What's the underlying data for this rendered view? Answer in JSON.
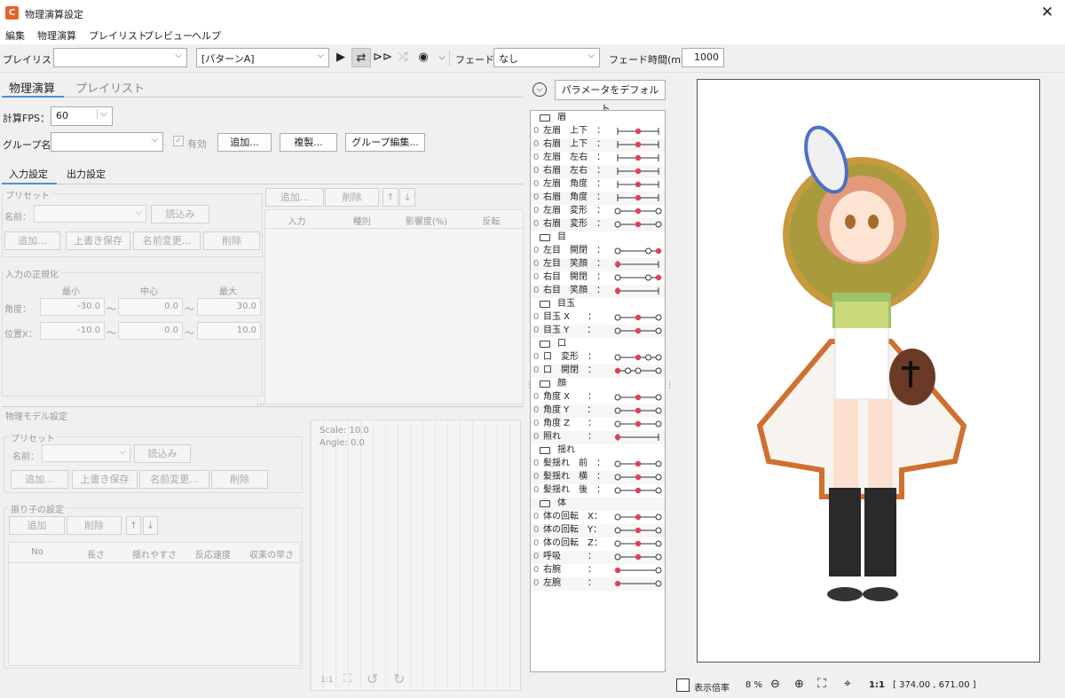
{
  "window": {
    "title": "物理演算設定",
    "close": "✕"
  },
  "menu": [
    "編集",
    "物理演算",
    "プレイリスト",
    "プレビュー",
    "ヘルプ"
  ],
  "toolbar": {
    "playlist_label": "プレイリスト：",
    "playlist_value": "",
    "pattern_value": "[パターンA]",
    "fade_label": "フェード：",
    "fade_value": "なし",
    "fade_time_label": "フェード時間(ms)：",
    "fade_time_value": "1000"
  },
  "tabs": {
    "main": [
      "物理演算",
      "プレイリスト"
    ],
    "sub": [
      "入力設定",
      "出力設定"
    ]
  },
  "physics": {
    "fps_label": "計算FPS：",
    "fps_value": "60",
    "group_label": "グループ名：",
    "enabled_label": "有効",
    "buttons": [
      "追加...",
      "複製...",
      "グループ編集..."
    ]
  },
  "input": {
    "preset_title": "プリセット",
    "name_label": "名前：",
    "load": "読込み",
    "preset_buttons": [
      "追加...",
      "上書き保存",
      "名前変更...",
      "削除"
    ],
    "table_buttons": [
      "追加...",
      "削除",
      "↑",
      "↓"
    ],
    "table_headers": [
      "入力",
      "種別",
      "影響度(%)",
      "反転"
    ],
    "normalize_title": "入力の正規化",
    "norm_headers": [
      "最小",
      "中心",
      "最大"
    ],
    "angle_label": "角度：",
    "angle": [
      "-30.0",
      "0.0",
      "30.0"
    ],
    "posx_label": "位置X：",
    "posx": [
      "-10.0",
      "0.0",
      "10.0"
    ],
    "tilde": "〜"
  },
  "model": {
    "title": "物理モデル設定",
    "preset_title": "プリセット",
    "name_label": "名前：",
    "load": "読込み",
    "preset_buttons": [
      "追加...",
      "上書き保存",
      "名前変更...",
      "削除"
    ],
    "pendulum_title": "振り子の設定",
    "pend_buttons": [
      "追加",
      "削除",
      "↑",
      "↓"
    ],
    "pend_headers": [
      "No",
      "長さ",
      "揺れやすさ",
      "反応速度",
      "収束の早さ"
    ],
    "scale": "Scale: 10.0",
    "angle": "Angle: 0.0",
    "ratio": "1:1"
  },
  "params": {
    "default_btn": "パラメータをデフォルト...",
    "rows": [
      {
        "type": "cat",
        "label": "眉"
      },
      {
        "label": "左眉　上下　：",
        "dots": [
          0.5
        ]
      },
      {
        "label": "右眉　上下　：",
        "dots": [
          0.5
        ]
      },
      {
        "label": "左眉　左右　：",
        "dots": [
          0.5
        ]
      },
      {
        "label": "右眉　左右　：",
        "dots": [
          0.5
        ]
      },
      {
        "label": "左眉　角度　：",
        "dots": [
          0.5
        ]
      },
      {
        "label": "右眉　角度　：",
        "dots": [
          0.5
        ]
      },
      {
        "label": "左眉　変形　：",
        "dots": [
          0.5
        ],
        "rings": [
          0,
          1
        ]
      },
      {
        "label": "右眉　変形　：",
        "dots": [
          0.5
        ],
        "rings": [
          0,
          1
        ]
      },
      {
        "type": "cat",
        "label": "目"
      },
      {
        "label": "左目　開閉　：",
        "dots": [
          1
        ],
        "rings": [
          0,
          0.75
        ]
      },
      {
        "label": "左目　笑顔　：",
        "dots": [
          0
        ]
      },
      {
        "label": "右目　開閉　：",
        "dots": [
          1
        ],
        "rings": [
          0,
          0.75
        ]
      },
      {
        "label": "右目　笑顔　：",
        "dots": [
          0
        ]
      },
      {
        "type": "cat",
        "label": "目玉"
      },
      {
        "label": "目玉 X　　：",
        "dots": [
          0.5
        ],
        "rings": [
          0,
          1
        ]
      },
      {
        "label": "目玉 Y　　：",
        "dots": [
          0.5
        ],
        "rings": [
          0,
          1
        ]
      },
      {
        "type": "cat",
        "label": "口"
      },
      {
        "label": "口　変形　：",
        "dots": [
          0.5
        ],
        "rings": [
          0,
          0.75,
          1
        ]
      },
      {
        "label": "口　開閉　：",
        "dots": [
          0
        ],
        "rings": [
          0.25,
          0.5,
          1
        ]
      },
      {
        "type": "cat",
        "label": "顔"
      },
      {
        "label": "角度 X　　：",
        "dots": [
          0.5
        ],
        "rings": [
          0,
          1
        ]
      },
      {
        "label": "角度 Y　　：",
        "dots": [
          0.5
        ],
        "rings": [
          0,
          1
        ]
      },
      {
        "label": "角度 Z　　：",
        "dots": [
          0.5
        ],
        "rings": [
          0,
          1
        ]
      },
      {
        "label": "照れ　　　：",
        "dots": [
          0
        ]
      },
      {
        "type": "cat",
        "label": "揺れ"
      },
      {
        "label": "髪揺れ　前　：",
        "dots": [
          0.5
        ],
        "rings": [
          0,
          1
        ]
      },
      {
        "label": "髪揺れ　横　：",
        "dots": [
          0.5
        ],
        "rings": [
          0,
          1
        ]
      },
      {
        "label": "髪揺れ　後　：",
        "dots": [
          0.5
        ],
        "rings": [
          0,
          1
        ]
      },
      {
        "type": "cat",
        "label": "体"
      },
      {
        "label": "体の回転　X：",
        "dots": [
          0.5
        ],
        "rings": [
          0,
          1
        ]
      },
      {
        "label": "体の回転　Y：",
        "dots": [
          0.5
        ],
        "rings": [
          0,
          1
        ]
      },
      {
        "label": "体の回転　Z：",
        "dots": [
          0.5
        ],
        "rings": [
          0,
          1
        ]
      },
      {
        "label": "呼吸　　　：",
        "dots": [
          0.5
        ],
        "rings": [
          0,
          1
        ]
      },
      {
        "label": "右腕　　　：",
        "dots": [
          0
        ],
        "rings": [
          1
        ]
      },
      {
        "label": "左腕　　　：",
        "dots": [
          0
        ],
        "rings": [
          1
        ]
      }
    ]
  },
  "status": {
    "zoom_label": "表示倍率",
    "zoom_value": "8 %",
    "ratio": "1:1",
    "coords": "[ 374.00 , 671.00 ]"
  },
  "colors": {
    "accent": "#e0405a",
    "tab_underline": "#4a90d9"
  }
}
